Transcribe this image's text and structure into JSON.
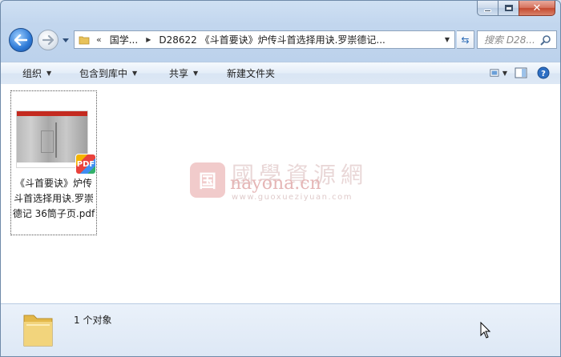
{
  "window": {
    "caption_buttons": [
      {
        "name": "minimize",
        "icon": "minimize-icon"
      },
      {
        "name": "maximize",
        "icon": "maximize-icon"
      },
      {
        "name": "close",
        "icon": "close-icon"
      }
    ]
  },
  "nav": {
    "crumbs": [
      "国学...",
      "D28622 《斗首要诀》炉传斗首选择用诀.罗崇德记..."
    ],
    "overflow": "«",
    "search_placeholder": "搜索 D28..."
  },
  "toolbar": {
    "organize": "组织",
    "include_in_library": "包含到库中",
    "share": "共享",
    "new_folder": "新建文件夹"
  },
  "files": [
    {
      "name": "《斗首要诀》炉传斗首选择用诀.罗崇德记 36筒子页.pdf",
      "badge": "PDF",
      "thumb_header": "PDF"
    }
  ],
  "watermark": {
    "logo_char": "国",
    "chinese": "國學資源網",
    "domain": "nayona.cn",
    "sub": "www.guoxueziyuan.com"
  },
  "status": {
    "count_text": "1 个对象"
  },
  "colors": {
    "accent": "#2d79d6",
    "close": "#c44a30",
    "frame": "#bcd2ec"
  }
}
